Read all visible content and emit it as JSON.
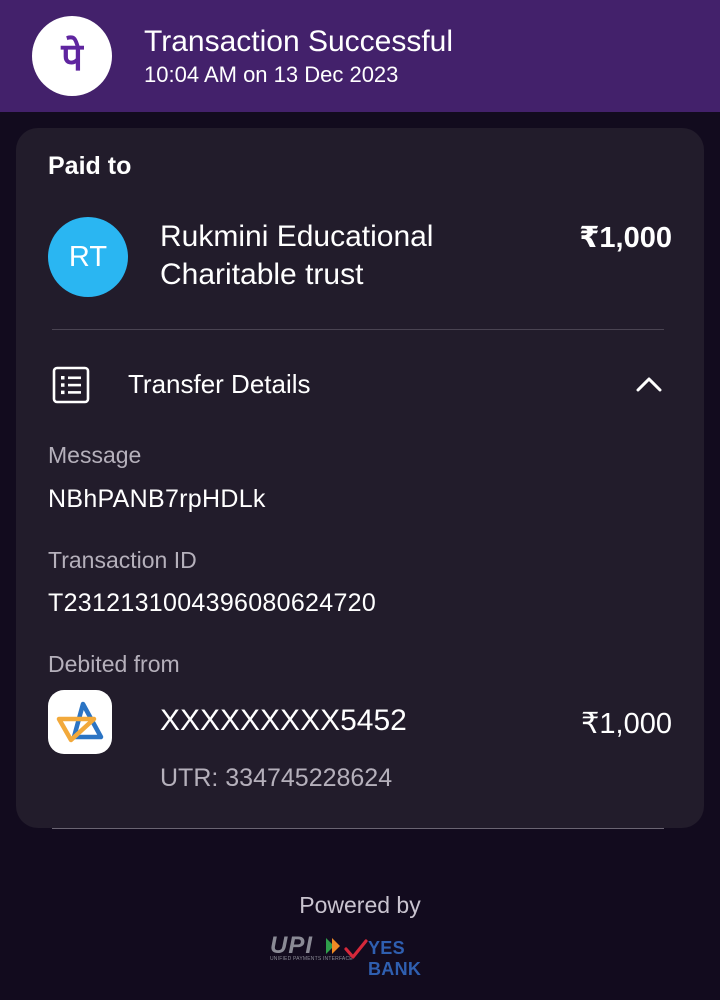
{
  "header": {
    "title": "Transaction Successful",
    "subtitle": "10:04 AM on 13 Dec 2023",
    "logo_glyph": "पे",
    "logo_color": "#5f259f",
    "background": "#43216b"
  },
  "paid_to": {
    "label": "Paid to",
    "avatar_initials": "RT",
    "avatar_color": "#2ab6f2",
    "name": "Rukmini Educational Charitable trust",
    "amount": "₹1,000"
  },
  "transfer_details": {
    "title": "Transfer Details",
    "icon": "list-details-icon",
    "toggle_icon": "chevron-up-icon",
    "message_label": "Message",
    "message_value": "NBhPANB7rpHDLk",
    "transaction_id_label": "Transaction ID",
    "transaction_id_value": "T2312131004396080624720",
    "debited_from_label": "Debited from",
    "account_number": "XXXXXXXXX5452",
    "account_amount": "₹1,000",
    "utr": "UTR: 334745228624",
    "bank_icon": "bank-logo-icon"
  },
  "footer": {
    "powered_by": "Powered by",
    "upi_logo": "UPI",
    "upi_tagline": "UNIFIED PAYMENTS INTERFACE",
    "bank_logo": "YES BANK",
    "bank_color": "#2f5fb0"
  }
}
